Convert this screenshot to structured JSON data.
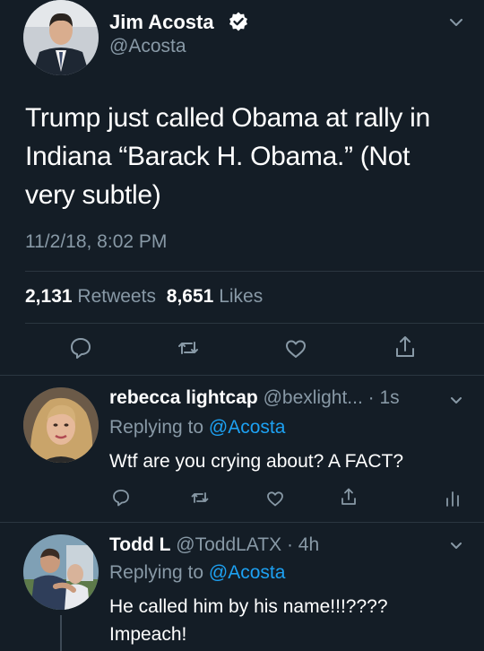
{
  "main_tweet": {
    "author_name": "Jim Acosta",
    "author_handle": "@Acosta",
    "text": "Trump just called Obama at rally in Indiana “Barack H. Obama.” (Not very subtle)",
    "timestamp": "11/2/18, 8:02 PM",
    "retweets_count": "2,131",
    "retweets_label": "Retweets",
    "likes_count": "8,651",
    "likes_label": "Likes"
  },
  "replies": [
    {
      "author_name": "rebecca lightcap",
      "author_handle": "@bexlight...",
      "time": "· 1s",
      "replying_prefix": "Replying to",
      "replying_to": "@Acosta",
      "text": "Wtf are you crying about? A FACT?"
    },
    {
      "author_name": "Todd L",
      "author_handle": "@ToddLATX",
      "time": "· 4h",
      "replying_prefix": "Replying to",
      "replying_to": "@Acosta",
      "text_line1": "He called him by his name!!!????",
      "text_line2": "Impeach!"
    }
  ],
  "colors": {
    "background": "#141d26",
    "muted": "#8899a6",
    "accent": "#1da1f2",
    "divider": "#2b3640"
  },
  "icons": [
    "verified-badge-icon",
    "chevron-down-icon",
    "reply-icon",
    "retweet-icon",
    "like-icon",
    "share-icon",
    "analytics-icon"
  ]
}
